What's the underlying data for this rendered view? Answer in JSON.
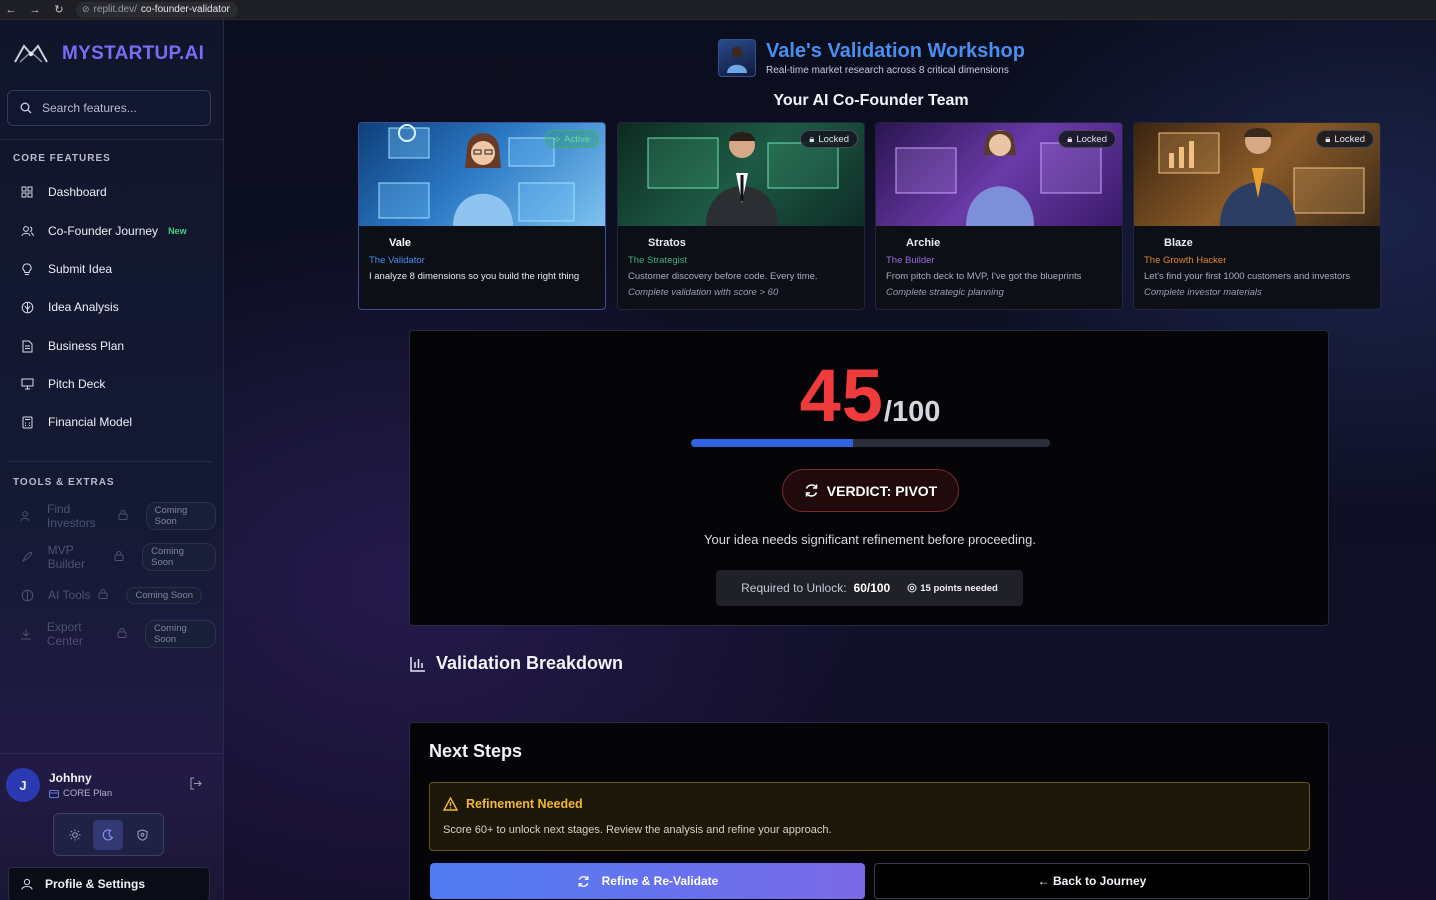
{
  "browser": {
    "url_host": "replit.dev/",
    "url_path": "co-founder-validator"
  },
  "sidebar": {
    "brand": "MYSTARTUP.AI",
    "search_placeholder": "Search features...",
    "core_label": "CORE FEATURES",
    "core_items": [
      {
        "label": "Dashboard",
        "icon": "grid-icon"
      },
      {
        "label": "Co-Founder Journey",
        "icon": "users-icon",
        "badge": "New"
      },
      {
        "label": "Submit Idea",
        "icon": "lightbulb-icon"
      },
      {
        "label": "Idea Analysis",
        "icon": "brain-icon"
      },
      {
        "label": "Business Plan",
        "icon": "document-icon"
      },
      {
        "label": "Pitch Deck",
        "icon": "presentation-icon"
      },
      {
        "label": "Financial Model",
        "icon": "calculator-icon"
      }
    ],
    "tools_label": "TOOLS & EXTRAS",
    "tools_items": [
      {
        "label": "Find Investors",
        "icon": "users-icon",
        "status": "Coming Soon"
      },
      {
        "label": "MVP Builder",
        "icon": "rocket-icon",
        "status": "Coming Soon"
      },
      {
        "label": "AI Tools",
        "icon": "brain-icon",
        "status": "Coming Soon"
      },
      {
        "label": "Export Center",
        "icon": "download-icon",
        "status": "Coming Soon"
      }
    ],
    "user": {
      "initial": "J",
      "name": "Johhny",
      "plan": "CORE Plan"
    },
    "profile_label": "Profile & Settings"
  },
  "workshop": {
    "title": "Vale's Validation Workshop",
    "subtitle": "Real-time market research across 8 critical dimensions",
    "team_title": "Your AI Co-Founder Team",
    "cards": [
      {
        "name": "Vale",
        "role": "The Validator",
        "role_color": "#4a8ef0",
        "desc": "I analyze 8 dimensions so you build the right thing",
        "status": "Active",
        "requirement": ""
      },
      {
        "name": "Stratos",
        "role": "The Strategist",
        "role_color": "#3fae79",
        "desc": "Customer discovery before code. Every time.",
        "status": "Locked",
        "requirement": "Complete validation with score > 60"
      },
      {
        "name": "Archie",
        "role": "The Builder",
        "role_color": "#9a6ee0",
        "desc": "From pitch deck to MVP, I've got the blueprints",
        "status": "Locked",
        "requirement": "Complete strategic planning"
      },
      {
        "name": "Blaze",
        "role": "The Growth Hacker",
        "role_color": "#e0862f",
        "desc": "Let's find your first 1000 customers and investors",
        "status": "Locked",
        "requirement": "Complete investor materials"
      }
    ]
  },
  "score": {
    "value": "45",
    "denominator": "/100",
    "progress_fraction": 0.45,
    "verdict": "VERDICT: PIVOT",
    "message": "Your idea needs significant refinement before proceeding.",
    "unlock_label": "Required to Unlock:",
    "unlock_value": "60/100",
    "points_needed": "15 points needed"
  },
  "breakdown_title": "Validation Breakdown",
  "next_steps": {
    "title": "Next Steps",
    "warning_title": "Refinement Needed",
    "warning_text": "Score 60+ to unlock next stages. Review the analysis and refine your approach.",
    "primary_button": "Refine & Re-Validate",
    "secondary_button": "← Back to Journey"
  }
}
